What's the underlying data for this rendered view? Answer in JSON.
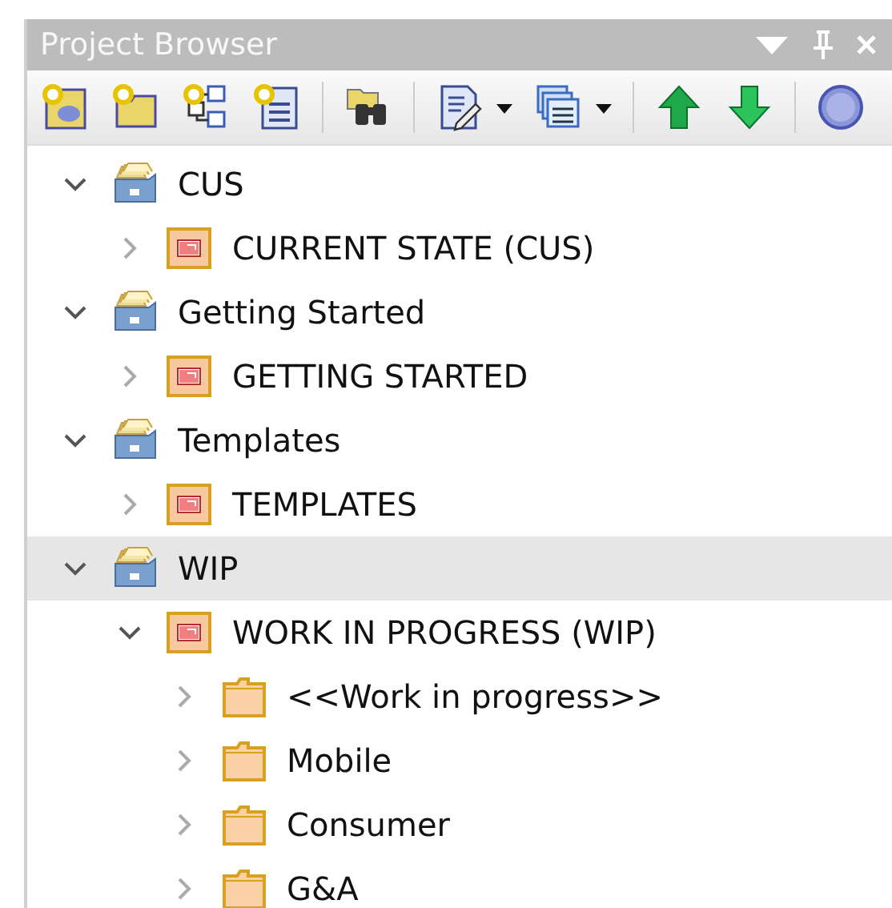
{
  "panel": {
    "title": "Project Browser"
  },
  "tree": [
    {
      "kind": "model",
      "label": "CUS",
      "expanded": true,
      "selected": false,
      "children": [
        {
          "kind": "package",
          "label": "CURRENT STATE (CUS)",
          "expanded": false,
          "selected": false
        }
      ]
    },
    {
      "kind": "model",
      "label": "Getting Started",
      "expanded": true,
      "selected": false,
      "children": [
        {
          "kind": "package",
          "label": "GETTING STARTED",
          "expanded": false,
          "selected": false
        }
      ]
    },
    {
      "kind": "model",
      "label": "Templates",
      "expanded": true,
      "selected": false,
      "children": [
        {
          "kind": "package",
          "label": "TEMPLATES",
          "expanded": false,
          "selected": false
        }
      ]
    },
    {
      "kind": "model",
      "label": "WIP",
      "expanded": true,
      "selected": true,
      "children": [
        {
          "kind": "package",
          "label": "WORK IN PROGRESS (WIP)",
          "expanded": true,
          "selected": false,
          "children": [
            {
              "kind": "folder",
              "label": "<<Work in progress>>",
              "expanded": false,
              "selected": false
            },
            {
              "kind": "folder",
              "label": "Mobile",
              "expanded": false,
              "selected": false
            },
            {
              "kind": "folder",
              "label": "Consumer",
              "expanded": false,
              "selected": false
            },
            {
              "kind": "folder",
              "label": "G&A",
              "expanded": false,
              "selected": false
            }
          ]
        }
      ]
    }
  ]
}
